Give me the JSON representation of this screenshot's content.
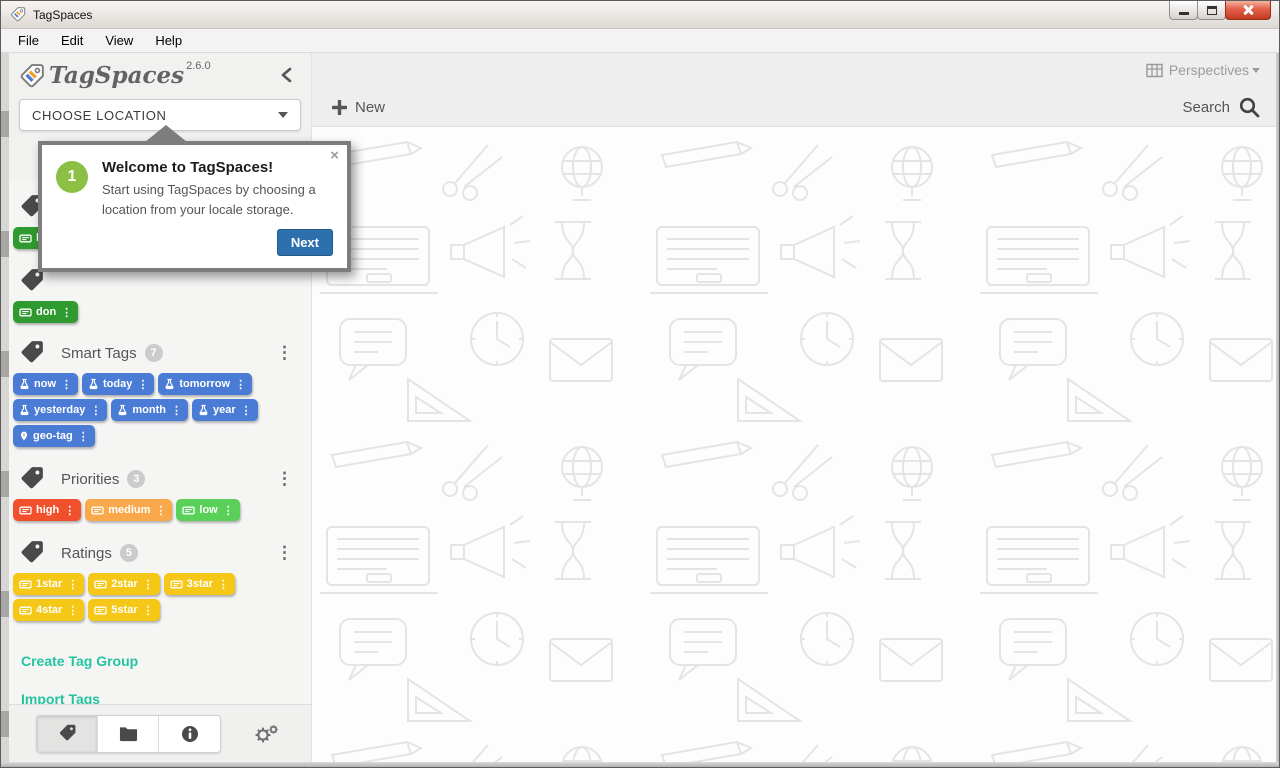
{
  "window": {
    "title": "TagSpaces",
    "controls": {
      "minimize": "minimize",
      "maximize": "maximize",
      "close": "close"
    }
  },
  "menu": {
    "items": [
      "File",
      "Edit",
      "View",
      "Help"
    ]
  },
  "sidebar": {
    "logo_text": "TagSpaces",
    "version": "2.6.0",
    "choose_location_label": "CHOOSE LOCATION",
    "hidden_tag_groups": [
      {
        "visible_tag_label": "boo",
        "color": "#2f9a2f",
        "icon": "keyboard"
      },
      {
        "visible_tag_label": "don",
        "color": "#2f9a2f",
        "icon": "keyboard"
      }
    ],
    "tag_groups": [
      {
        "name": "Smart Tags",
        "count": "7",
        "color": "#4a7bd5",
        "tags": [
          {
            "label": "now",
            "icon": "flask"
          },
          {
            "label": "today",
            "icon": "flask"
          },
          {
            "label": "tomorrow",
            "icon": "flask"
          },
          {
            "label": "yesterday",
            "icon": "flask"
          },
          {
            "label": "month",
            "icon": "flask"
          },
          {
            "label": "year",
            "icon": "flask"
          },
          {
            "label": "geo-tag",
            "icon": "pin"
          }
        ]
      },
      {
        "name": "Priorities",
        "count": "3",
        "color": "#f0512c",
        "tags": [
          {
            "label": "high",
            "icon": "keyboard",
            "color": "#f0512c"
          },
          {
            "label": "medium",
            "icon": "keyboard",
            "color": "#f9a84b"
          },
          {
            "label": "low",
            "icon": "keyboard",
            "color": "#59d159"
          }
        ]
      },
      {
        "name": "Ratings",
        "count": "5",
        "color": "#f5c717",
        "tags": [
          {
            "label": "1star",
            "icon": "keyboard",
            "color": "#f5c717"
          },
          {
            "label": "2star",
            "icon": "keyboard",
            "color": "#f5c717"
          },
          {
            "label": "3star",
            "icon": "keyboard",
            "color": "#f5c717"
          },
          {
            "label": "4star",
            "icon": "keyboard",
            "color": "#f5c717"
          },
          {
            "label": "5star",
            "icon": "keyboard",
            "color": "#f5c717"
          }
        ]
      }
    ],
    "links": {
      "create_tag_group": "Create Tag Group",
      "import_tags": "Import Tags"
    }
  },
  "popup": {
    "step_number": "1",
    "title": "Welcome to TagSpaces!",
    "body": "Start using TagSpaces by choosing a location from your locale storage.",
    "next_label": "Next",
    "close_symbol": "×"
  },
  "main": {
    "perspectives_label": "Perspectives",
    "new_label": "New",
    "search_label": "Search"
  },
  "colors": {
    "smart_tag_blue": "#4a7bd5",
    "tag_green": "#2f9a2f",
    "priority_high": "#f0512c",
    "priority_medium": "#f9a84b",
    "priority_low": "#59d159",
    "rating_yellow": "#f5c717",
    "link_teal": "#25c4a0",
    "next_button_blue": "#2c70ae",
    "step_circle_green": "#8cc044"
  }
}
